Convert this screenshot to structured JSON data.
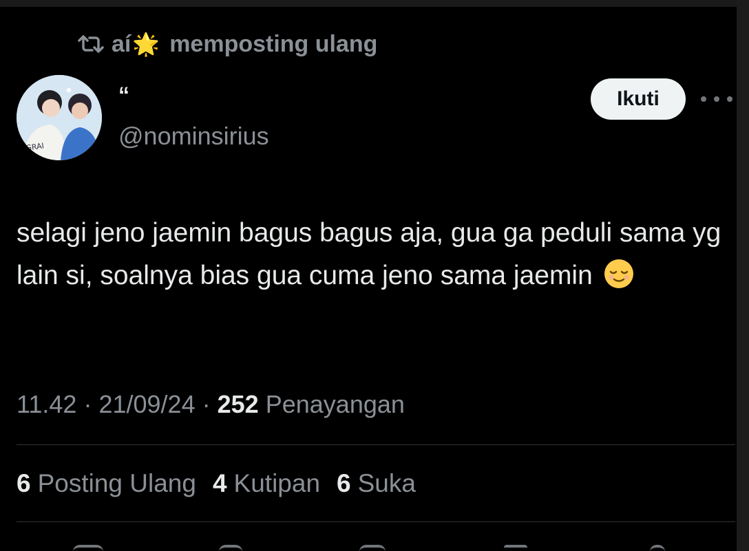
{
  "repost": {
    "user": "aí",
    "user_emoji": "🌟",
    "label": "memposting ulang"
  },
  "author": {
    "display_name": "“",
    "handle": "@nominsirius"
  },
  "follow_label": "Ikuti",
  "tweet": {
    "text": "selagi jeno jaemin bagus bagus aja, gua ga peduli sama yg lain si, soalnya bias gua cuma jeno sama jaemin",
    "emoji": "😌"
  },
  "meta": {
    "time": "11.42",
    "separator": "·",
    "date": "21/09/24",
    "views_count": "252",
    "views_label": "Penayangan"
  },
  "stats": [
    {
      "count": "6",
      "label": "Posting Ulang"
    },
    {
      "count": "4",
      "label": "Kutipan"
    },
    {
      "count": "6",
      "label": "Suka"
    }
  ],
  "icons": {
    "repost": "repost-icon",
    "more": "more-icon",
    "reply": "reply-icon",
    "like": "heart-icon",
    "bookmark": "bookmark-icon",
    "share": "share-icon"
  },
  "colors": {
    "background": "#000000",
    "text_primary": "#e7e9ea",
    "text_secondary": "#8b9096",
    "follow_button": "#eff3f4",
    "divider": "#2f3336"
  }
}
